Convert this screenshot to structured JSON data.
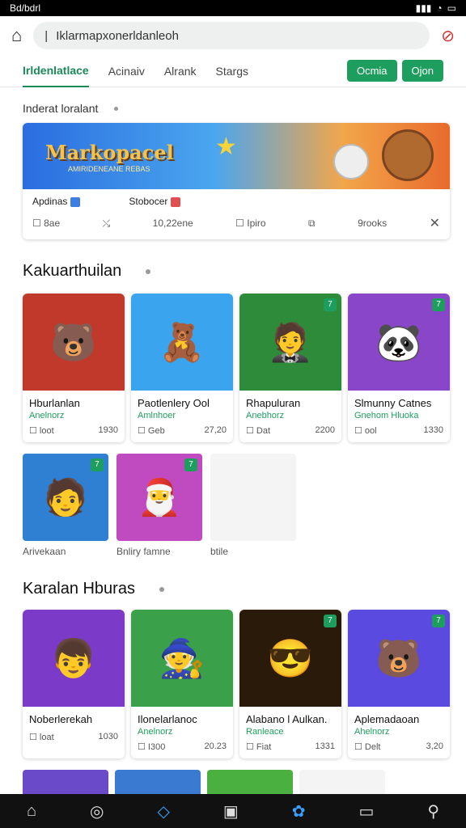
{
  "status": {
    "left": "Bd/bdrl"
  },
  "search": {
    "placeholder": "Iklarmapxonerldanleoh"
  },
  "tabs": [
    {
      "label": "Irldenlatlace"
    },
    {
      "label": "Acinaiv"
    },
    {
      "label": "Alrank"
    },
    {
      "label": "Stargs"
    }
  ],
  "tab_buttons": [
    "Ocmia",
    "Ojon"
  ],
  "featured": {
    "section_label": "Inderat loralant",
    "banner_title": "Markopacel",
    "banner_sub": "AMIRIDENEANE REBAS",
    "left_name": "Apdinas",
    "right_name": "Stobocer",
    "stat1": "8ae",
    "stat2": "10,22ene",
    "stat3": "Ipiro",
    "stat4": "9rooks"
  },
  "section1": {
    "title": "Kakuarthuilan",
    "cards": [
      {
        "title": "Hburlanlan",
        "sub": "Anelnorz",
        "left": "loot",
        "right": "1930",
        "color": "#c0392b",
        "emoji": "🐻"
      },
      {
        "title": "Paotlenlery Ool",
        "sub": "Amlnhoer",
        "left": "Geb",
        "right": "27,20",
        "color": "#3aa5ee",
        "emoji": "🧸"
      },
      {
        "title": "Rhapuluran",
        "sub": "Anebhorz",
        "left": "Dat",
        "right": "2200",
        "color": "#2e8b3a",
        "emoji": "🤵"
      },
      {
        "title": "Slmunny Catnes",
        "sub": "Gnehom Hluoka",
        "left": "ool",
        "right": "1330",
        "color": "#8a46c8",
        "emoji": "🐼"
      }
    ]
  },
  "smallrow": [
    {
      "label": "Arivekaan",
      "color": "#2f7fd2",
      "emoji": "🧑"
    },
    {
      "label": "Bnliry famne",
      "color": "#c04ac0",
      "emoji": "🎅"
    },
    {
      "label": "btile",
      "color": "#f4f4f4",
      "emoji": ""
    }
  ],
  "section2": {
    "title": "Karalan Hburas",
    "cards": [
      {
        "title": "Noberlerekah",
        "sub": "",
        "left": "loat",
        "right": "1030",
        "color": "#7b3ac8",
        "emoji": "👦"
      },
      {
        "title": "Ilonelarlanoc",
        "sub": "Anelnorz",
        "left": "I300",
        "right": "20.23",
        "color": "#3aa04a",
        "emoji": "🧙"
      },
      {
        "title": "Alabano l Aulkan.",
        "sub": "Ranleace",
        "left": "Fiat",
        "right": "1331",
        "color": "#2a1a0a",
        "emoji": "😎"
      },
      {
        "title": "Aplemadaoan",
        "sub": "Ahelnorz",
        "left": "Delt",
        "right": "3,20",
        "color": "#5a4ae0",
        "emoji": "🐻"
      }
    ]
  },
  "partial_colors": [
    "#6a4ac8",
    "#3a7ad0",
    "#4ab040",
    "#f4f4f4"
  ]
}
